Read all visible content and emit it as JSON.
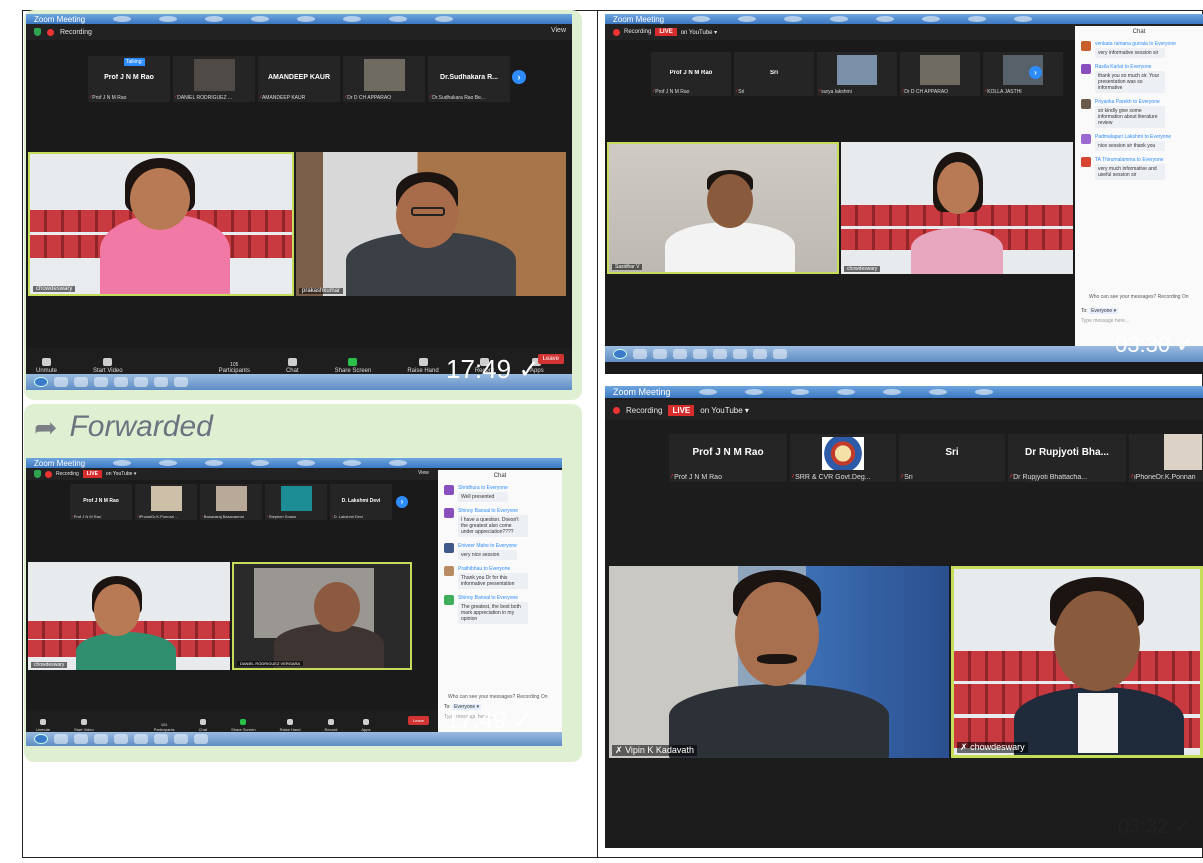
{
  "forwarded_label": "Forwarded",
  "panel_top_left": {
    "title": "Zoom Meeting",
    "recording": "Recording",
    "view": "View",
    "speaking_badge": "Talking:",
    "thumbnails": [
      {
        "name": "Prof J N M Rao",
        "caption": "Prof J N M Rao"
      },
      {
        "name": "",
        "caption": "DANIEL RODRIGUEZ ..."
      },
      {
        "name": "AMANDEEP KAUR",
        "caption": "AMANDEEP KAUR"
      },
      {
        "name": "",
        "caption": "Dr D CH APPARAO"
      },
      {
        "name": "Dr.Sudhakara R...",
        "caption": "Dr.Sudhakara Rao Be..."
      }
    ],
    "videos": [
      {
        "label": "chowdeswary"
      },
      {
        "label": "prakashkumar"
      }
    ],
    "toolbar": [
      "Unmute",
      "Start Video",
      "Participants",
      "Chat",
      "Share Screen",
      "Raise Hand",
      "Record",
      "Apps"
    ],
    "participants_count": "105",
    "leave": "Leave",
    "time": "17:49 ✓"
  },
  "panel_bottom_left": {
    "title": "Zoom Meeting",
    "recording": "Recording",
    "live": "LIVE",
    "youtube": "on YouTube ▾",
    "view": "View",
    "thumbnails": [
      {
        "name": "Prof J N M Rao",
        "caption": "Prof J N M Rao"
      },
      {
        "name": "",
        "caption": "iPhoneDr.K.Ponnari ..."
      },
      {
        "name": "",
        "caption": "Basavaraj Basavannar"
      },
      {
        "name": "",
        "caption": "Stephen Soans"
      },
      {
        "name": "D. Lakshmi Devi",
        "caption": "D. Lakshmi Devi"
      }
    ],
    "videos": [
      {
        "label": "chowdeswary"
      },
      {
        "label": "DANIEL RODRIGUEZ VERGARA"
      }
    ],
    "toolbar": [
      "Unmute",
      "Start Video",
      "Participants",
      "Chat",
      "Share Screen",
      "Raise Hand",
      "Record",
      "Apps"
    ],
    "participants_count": "101",
    "leave": "Leave",
    "chat": {
      "title": "Chat",
      "messages": [
        {
          "from": "Shridhura to Everyone",
          "text": "Well presented"
        },
        {
          "from": "Shinoy Bansal to Everyone",
          "text": "I have a question. Doesn't the greatest also come under appreciation????"
        },
        {
          "from": "Eniveer Mahe to Everyone",
          "text": "very nice session"
        },
        {
          "from": "Prathibhau to Everyone",
          "text": "Thank you Dr for this informative presentation"
        },
        {
          "from": "Shinoy Bansal to Everyone",
          "text": "The greatest, the best both mark appreciation in my opinion"
        }
      ],
      "who_can_see": "Who can see your messages? Recording On",
      "to_label": "To:",
      "to_value": "Everyone ▾",
      "placeholder": "Type message here..."
    },
    "time": "17:49 ✓"
  },
  "panel_top_right": {
    "title": "Zoom Meeting",
    "recording": "Recording",
    "live": "LIVE",
    "youtube": "on YouTube ▾",
    "thumbnails": [
      {
        "name": "Prof J N M Rao",
        "caption": "Prof J N M Rao"
      },
      {
        "name": "Sri",
        "caption": "Sri"
      },
      {
        "name": "",
        "caption": "surya lakshmi"
      },
      {
        "name": "",
        "caption": "Dr D CH APPARAO"
      },
      {
        "name": "",
        "caption": "KOLLA JASTHI"
      }
    ],
    "videos": [
      {
        "label": "Sasidhar V"
      },
      {
        "label": "chowdeswary"
      }
    ],
    "chat": {
      "title": "Chat",
      "messages": [
        {
          "from": "venkata ramana gurrala to Everyone",
          "text": "very informative session sir"
        },
        {
          "from": "Rasila Karlat to Everyone",
          "text": "thank you so much sir. Your presentation was so informative"
        },
        {
          "from": "Priyanka Parekh to Everyone",
          "text": "sir kindly give some information about literature review"
        },
        {
          "from": "Padmalapuri Lakshmi to Everyone",
          "text": "nice session sir thank you"
        },
        {
          "from": "TA Thirumalamma to Everyone",
          "text": "very much informative and useful session sir"
        }
      ],
      "who_can_see": "Who can see your messages? Recording On",
      "to_label": "To:",
      "to_value": "Everyone ▾",
      "placeholder": "Type message here..."
    },
    "time": "03:30 ✓"
  },
  "panel_bottom_right": {
    "title": "Zoom Meeting",
    "recording": "Recording",
    "live": "LIVE",
    "youtube": "on YouTube ▾",
    "thumbnails": [
      {
        "name": "Prof J N M Rao",
        "caption": "Prof J N M Rao"
      },
      {
        "name": "",
        "caption": "SRR & CVR Govt.Deg..."
      },
      {
        "name": "Sri",
        "caption": "Sri"
      },
      {
        "name": "Dr Rupjyoti Bha...",
        "caption": "Dr Rupjyoti Bhattacha..."
      },
      {
        "name": "",
        "caption": "iPhoneDr.K.Ponnari"
      }
    ],
    "videos": [
      {
        "label": "Vipin K Kadavath"
      },
      {
        "label": "chowdeswary"
      }
    ],
    "time": "03:32 ✓"
  },
  "colors": {
    "whatsapp_green": "#dff0d2",
    "zoom_blue": "#2d8cff",
    "live_red": "#d82d2d",
    "seat_red": "#c93a40"
  }
}
